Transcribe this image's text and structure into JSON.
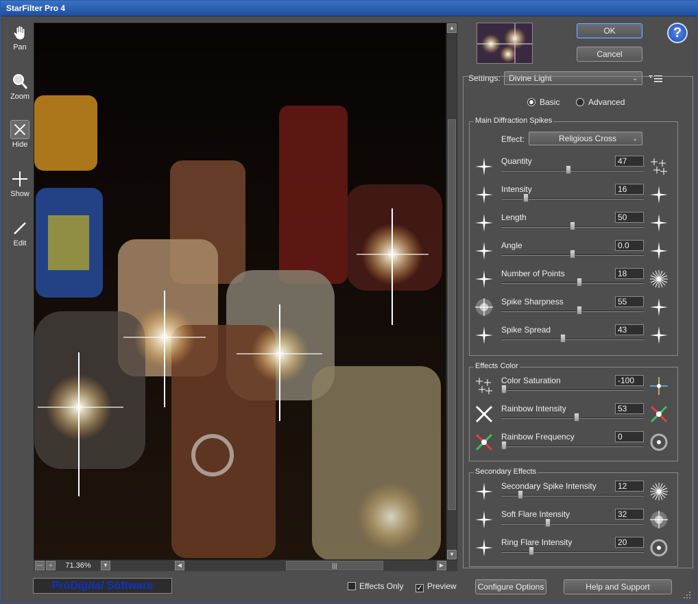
{
  "window": {
    "title": "StarFilter Pro 4"
  },
  "tools": [
    {
      "label": "Pan",
      "icon": "hand-icon"
    },
    {
      "label": "Zoom",
      "icon": "magnifier-icon"
    },
    {
      "label": "Hide",
      "icon": "hide-icon",
      "active": true
    },
    {
      "label": "Show",
      "icon": "crosshair-icon"
    },
    {
      "label": "Edit",
      "icon": "pencil-icon"
    }
  ],
  "preview": {
    "zoom": "71.36%"
  },
  "buttons": {
    "ok": "OK",
    "cancel": "Cancel",
    "help": "?",
    "configure": "Configure Options",
    "support": "Help and Support"
  },
  "settings": {
    "label": "Settings:",
    "value": "Divine Light",
    "mode_basic": "Basic",
    "mode_advanced": "Advanced",
    "mode_selected": "Basic"
  },
  "main": {
    "title": "Main Diffraction Spikes",
    "effect_label": "Effect:",
    "effect_value": "Religious Cross",
    "sliders": [
      {
        "label": "Quantity",
        "value": "47",
        "pos": 0.47
      },
      {
        "label": "Intensity",
        "value": "16",
        "pos": 0.16
      },
      {
        "label": "Length",
        "value": "50",
        "pos": 0.5
      },
      {
        "label": "Angle",
        "value": "0.0",
        "pos": 0.5
      },
      {
        "label": "Number of Points",
        "value": "18",
        "pos": 0.55
      },
      {
        "label": "Spike Sharpness",
        "value": "55",
        "pos": 0.55
      },
      {
        "label": "Spike Spread",
        "value": "43",
        "pos": 0.43
      }
    ]
  },
  "color": {
    "title": "Effects Color",
    "sliders": [
      {
        "label": "Color Saturation",
        "value": "-100",
        "pos": 0.0
      },
      {
        "label": "Rainbow Intensity",
        "value": "53",
        "pos": 0.53
      },
      {
        "label": "Rainbow Frequency",
        "value": "0",
        "pos": 0.0
      }
    ]
  },
  "secondary": {
    "title": "Secondary Effects",
    "sliders": [
      {
        "label": "Secondary Spike Intensity",
        "value": "12",
        "pos": 0.12
      },
      {
        "label": "Soft Flare Intensity",
        "value": "32",
        "pos": 0.32
      },
      {
        "label": "Ring Flare Intensity",
        "value": "20",
        "pos": 0.2
      }
    ]
  },
  "footer": {
    "effects_only": "Effects Only",
    "preview": "Preview",
    "effects_only_checked": false,
    "preview_checked": true
  },
  "logo": {
    "pro": "Pro",
    "digital": "Digital",
    "software": " Software"
  },
  "colors": {
    "accent": "#3a6cc0",
    "panel": "#4e4e4e",
    "title": "#1f4f9c"
  }
}
